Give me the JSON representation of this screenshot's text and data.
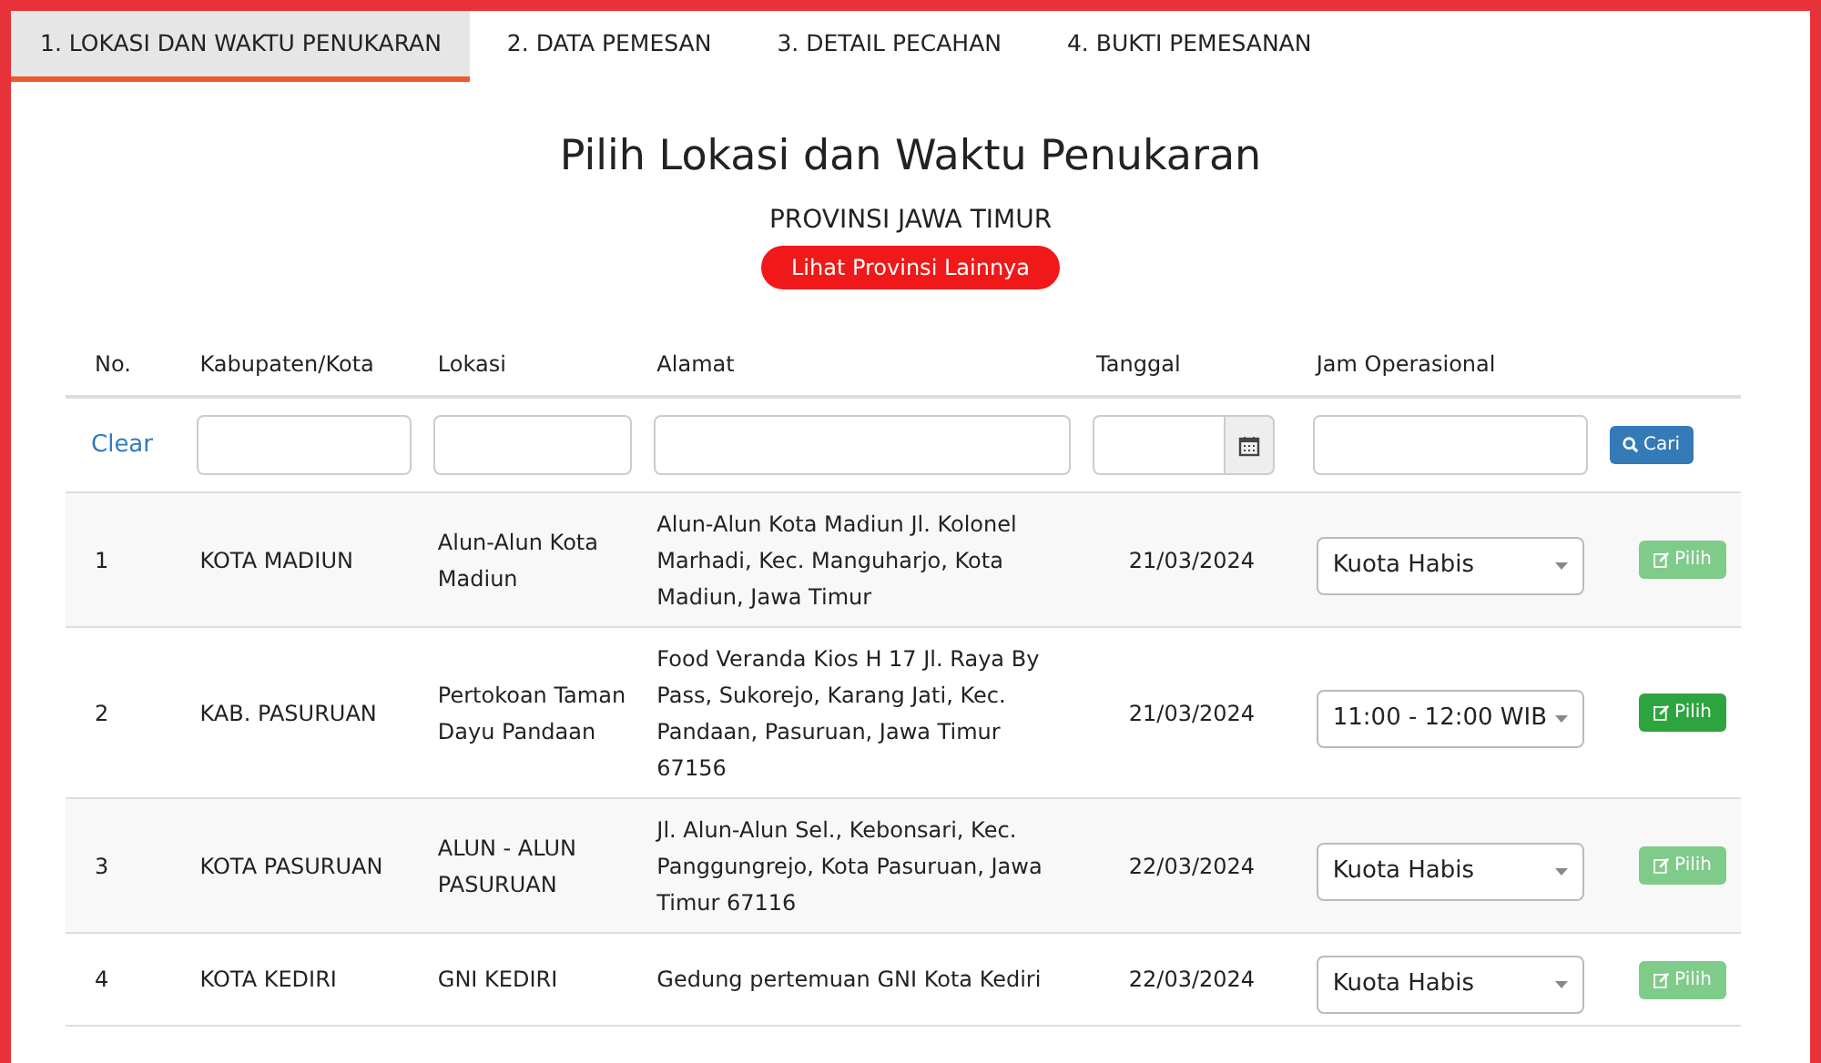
{
  "tabs": [
    {
      "label": "1. LOKASI DAN WAKTU PENUKARAN",
      "selected": true
    },
    {
      "label": "2. DATA PEMESAN",
      "selected": false
    },
    {
      "label": "3. DETAIL PECAHAN",
      "selected": false
    },
    {
      "label": "4. BUKTI PEMESANAN",
      "selected": false
    }
  ],
  "title": "Pilih Lokasi dan Waktu Penukaran",
  "province": "PROVINSI JAWA TIMUR",
  "province_button": "Lihat Provinsi Lainnya",
  "table": {
    "columns": [
      "No.",
      "Kabupaten/Kota",
      "Lokasi",
      "Alamat",
      "Tanggal",
      "Jam Operasional"
    ],
    "filter": {
      "clear": "Clear",
      "search_button": "Cari"
    },
    "rows": [
      {
        "no": "1",
        "kabupaten": "KOTA MADIUN",
        "lokasi": "Alun-Alun Kota Madiun",
        "alamat": "Alun-Alun Kota Madiun Jl. Kolonel Marhadi, Kec. Manguharjo, Kota Madiun, Jawa Timur",
        "tanggal": "21/03/2024",
        "jam": "Kuota Habis",
        "button": "Pilih",
        "disabled": true
      },
      {
        "no": "2",
        "kabupaten": "KAB. PASURUAN",
        "lokasi": "Pertokoan Taman Dayu Pandaan",
        "alamat": "Food Veranda Kios H 17 Jl. Raya By Pass, Sukorejo, Karang Jati, Kec. Pandaan, Pasuruan, Jawa Timur 67156",
        "tanggal": "21/03/2024",
        "jam": "11:00 - 12:00 WIB",
        "button": "Pilih",
        "disabled": false
      },
      {
        "no": "3",
        "kabupaten": "KOTA PASURUAN",
        "lokasi": "ALUN - ALUN PASURUAN",
        "alamat": "Jl. Alun-Alun Sel., Kebonsari, Kec. Panggungrejo, Kota Pasuruan, Jawa Timur 67116",
        "tanggal": "22/03/2024",
        "jam": "Kuota Habis",
        "button": "Pilih",
        "disabled": true
      },
      {
        "no": "4",
        "kabupaten": "KOTA KEDIRI",
        "lokasi": "GNI KEDIRI",
        "alamat": "Gedung pertemuan GNI Kota Kediri",
        "tanggal": "22/03/2024",
        "jam": "Kuota Habis",
        "button": "Pilih",
        "disabled": true
      }
    ]
  }
}
